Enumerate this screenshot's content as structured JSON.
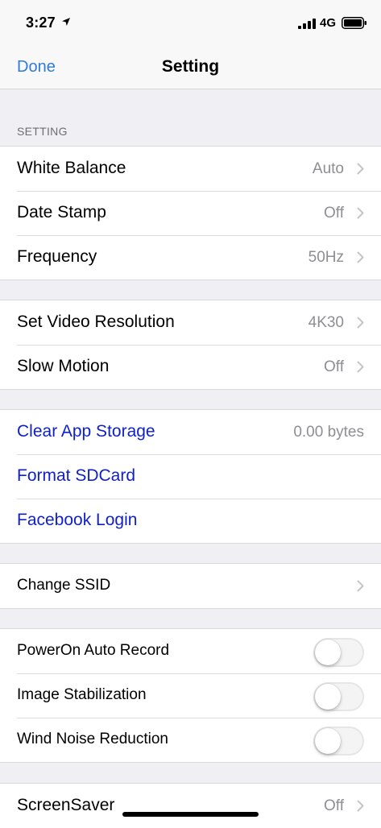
{
  "status_bar": {
    "time": "3:27",
    "network": "4G"
  },
  "nav": {
    "done_label": "Done",
    "title": "Setting"
  },
  "section_header": "SETTING",
  "group1": [
    {
      "label": "White Balance",
      "value": "Auto"
    },
    {
      "label": "Date Stamp",
      "value": "Off"
    },
    {
      "label": "Frequency",
      "value": "50Hz"
    }
  ],
  "group2": [
    {
      "label": "Set Video Resolution",
      "value": "4K30"
    },
    {
      "label": "Slow Motion",
      "value": "Off"
    }
  ],
  "group3": [
    {
      "label": "Clear App Storage",
      "value": "0.00 bytes"
    },
    {
      "label": "Format SDCard"
    },
    {
      "label": "Facebook Login"
    }
  ],
  "group4": [
    {
      "label": "Change SSID"
    }
  ],
  "group5": [
    {
      "label": "PowerOn Auto Record",
      "on": false
    },
    {
      "label": "Image Stabilization",
      "on": false
    },
    {
      "label": "Wind Noise Reduction",
      "on": false
    }
  ],
  "group6": [
    {
      "label": "ScreenSaver",
      "value": "Off"
    }
  ],
  "colors": {
    "link_blue": "#0f1fcc",
    "nav_blue": "#2f7bd6",
    "secondary_text": "#8e8e93"
  }
}
